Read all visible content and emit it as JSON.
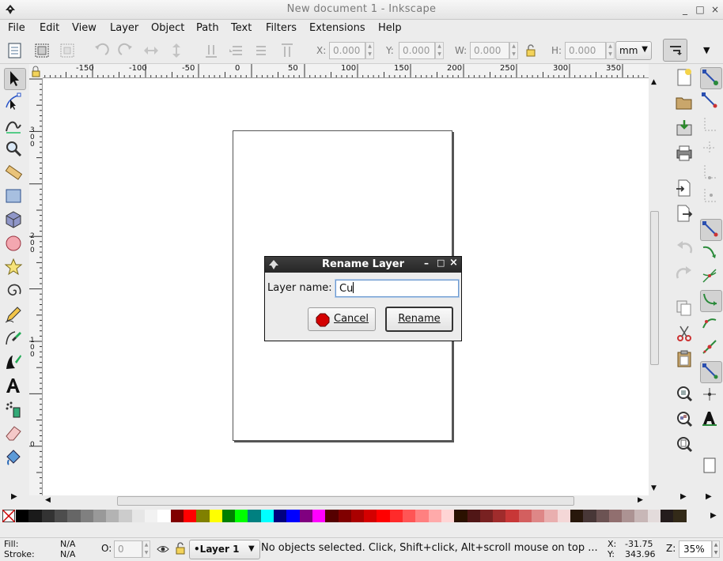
{
  "window": {
    "title": "New document 1 - Inkscape",
    "controls": [
      "_",
      "□",
      "×"
    ]
  },
  "menu": [
    "File",
    "Edit",
    "View",
    "Layer",
    "Object",
    "Path",
    "Text",
    "Filters",
    "Extensions",
    "Help"
  ],
  "controls_bar": {
    "x_label": "X:",
    "x_value": "0.000",
    "y_label": "Y:",
    "y_value": "0.000",
    "w_label": "W:",
    "w_value": "0.000",
    "h_label": "H:",
    "h_value": "0.000",
    "unit": "mm"
  },
  "ruler": {
    "h_ticks": [
      "-150",
      "-100",
      "-50",
      "0",
      "50",
      "100",
      "150",
      "200",
      "250",
      "300",
      "350"
    ],
    "v_ticks": [
      "3\n0\n0",
      "2\n0\n0",
      "1\n0\n0",
      "0"
    ]
  },
  "dialog": {
    "title": "Rename Layer",
    "field_label": "Layer name:",
    "field_value": "Cu",
    "cancel_label": "Cancel",
    "rename_label": "Rename"
  },
  "palette": [
    "#000000",
    "#1a1a1a",
    "#333333",
    "#4d4d4d",
    "#666666",
    "#808080",
    "#999999",
    "#b3b3b3",
    "#cccccc",
    "#e6e6e6",
    "#f2f2f2",
    "#ffffff",
    "#800000",
    "#ff0000",
    "#808000",
    "#ffff00",
    "#008000",
    "#00ff00",
    "#008080",
    "#00ffff",
    "#000080",
    "#0000ff",
    "#800080",
    "#ff00ff",
    "#550000",
    "#800000",
    "#aa0000",
    "#d40000",
    "#ff0000",
    "#ff2a2a",
    "#ff5555",
    "#ff8080",
    "#ffaaaa",
    "#ffd5d5",
    "#2b1100",
    "#501616",
    "#782121",
    "#a02c2c",
    "#c83737",
    "#d35f5f",
    "#de8787",
    "#e9afaf",
    "#f4d7d7",
    "#28170b",
    "#483737",
    "#6c5353",
    "#916f6f",
    "#ac9393",
    "#c8b7b7",
    "#e3dbdb",
    "#241c1c",
    "#332a18"
  ],
  "status": {
    "fill_label": "Fill:",
    "fill_value": "N/A",
    "stroke_label": "Stroke:",
    "stroke_value": "N/A",
    "opacity_label": "O:",
    "opacity_value": "0",
    "layer": "•Layer 1",
    "message": "No objects selected. Click, Shift+click, Alt+scroll mouse on top ...",
    "x_label": "X:",
    "x_value": "-31.75",
    "y_label": "Y:",
    "y_value": "343.96",
    "zoom_label": "Z:",
    "zoom_value": "35%"
  }
}
